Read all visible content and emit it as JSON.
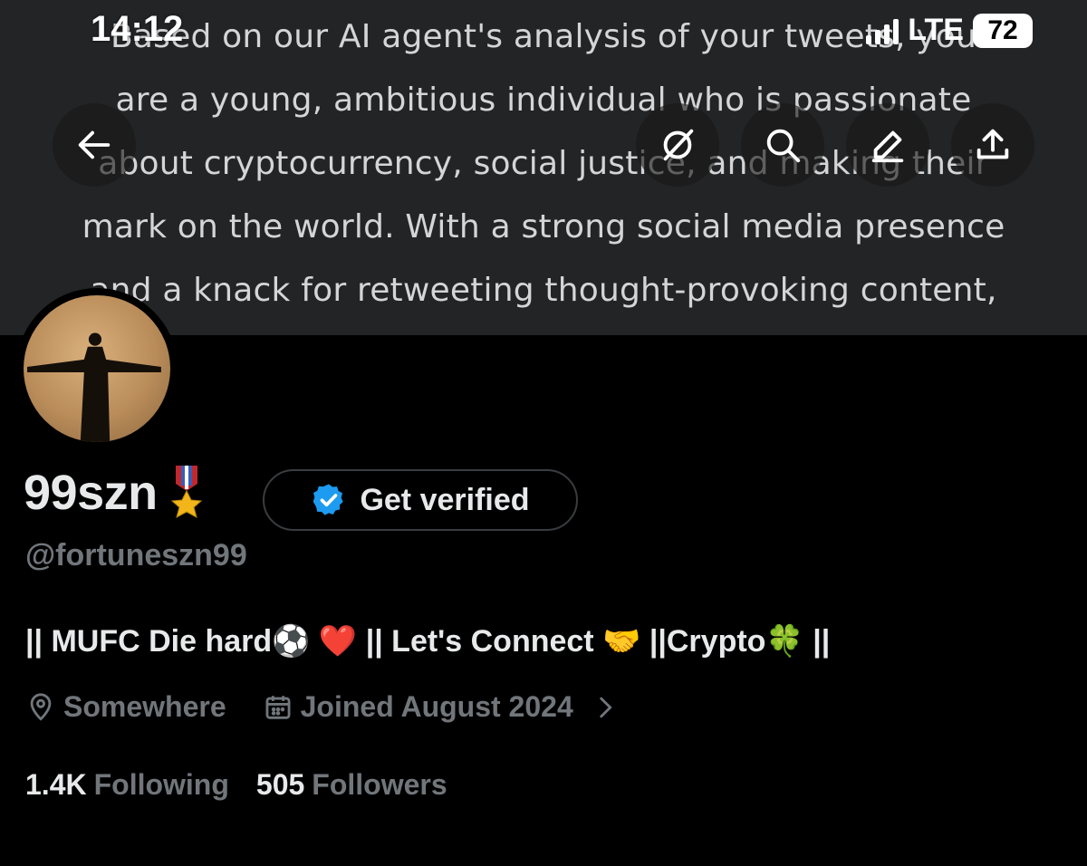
{
  "status_bar": {
    "time": "14:12",
    "network": "LTE",
    "battery": "72"
  },
  "banner": {
    "lines": [
      "Based on our AI agent's analysis of your tweets, you",
      "are a young, ambitious individual who is passionate",
      "about cryptocurrency, social justice, and making their",
      "mark on the world. With a strong social media presence",
      "and a knack for retweeting thought-provoking content,"
    ]
  },
  "nav": {
    "back_icon": "back-arrow-icon",
    "grok_icon": "grok-icon",
    "search_icon": "search-icon",
    "edit_icon": "edit-icon",
    "share_icon": "share-icon"
  },
  "profile": {
    "display_name": "99szn",
    "name_emoji": "🎖️",
    "get_verified_label": "Get verified",
    "handle": "@fortuneszn99",
    "bio": "|| MUFC Die hard⚽️ ❤️ || Let's Connect 🤝 ||Crypto🍀 ||",
    "location": "Somewhere",
    "joined": "Joined August 2024",
    "following_count": "1.4K",
    "following_label": "Following",
    "followers_count": "505",
    "followers_label": "Followers"
  },
  "colors": {
    "background": "#000000",
    "banner": "#232426",
    "primary_text": "#e7e9ea",
    "secondary_text": "#71767b",
    "verified_blue": "#1d9bf0"
  }
}
